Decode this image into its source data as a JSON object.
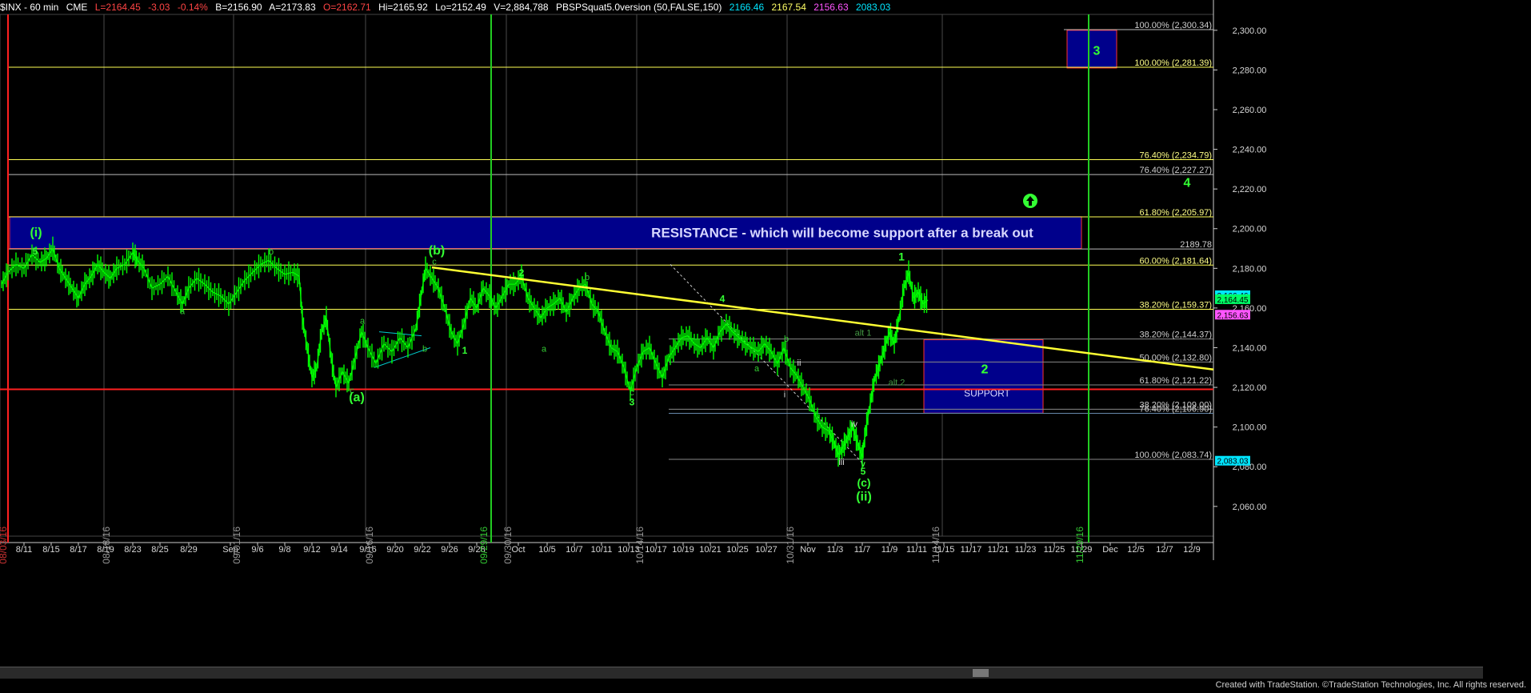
{
  "header": {
    "symbol": "$INX - 60 min",
    "exchange": "CME",
    "last": "L=2164.45",
    "change": "-3.03",
    "change_pct": "-0.14%",
    "bid": "B=2156.90",
    "ask": "A=2173.83",
    "open": "O=2162.71",
    "high": "Hi=2165.92",
    "low": "Lo=2152.49",
    "volume": "V=2,884,788",
    "indicator": "PBSPSquat5.0version (50,FALSE,150)",
    "ind_values": [
      {
        "text": "2166.46",
        "color": "#00e5ff"
      },
      {
        "text": "2167.54",
        "color": "#ffff66"
      },
      {
        "text": "2156.63",
        "color": "#ff55ff"
      },
      {
        "text": "2083.03",
        "color": "#00e5ff"
      }
    ]
  },
  "colors": {
    "background": "#000000",
    "bullish": "#00ff00",
    "bearish": "#00dd00",
    "trendline": "#ffff33",
    "resistance_box": "#00008b",
    "support_line": "#ff2020",
    "label_green": "#33ff33",
    "axis_text": "#d8d8d8"
  },
  "chart_data": {
    "type": "line",
    "title": "$INX - 60 min",
    "ylim": [
      2045,
      2308
    ],
    "xlim": [
      0,
      1517
    ],
    "grid": true,
    "y_ticks": [
      2060,
      2080,
      2100,
      2120,
      2140,
      2160,
      2180,
      2200,
      2220,
      2240,
      2260,
      2280,
      2300
    ],
    "y_tick_labels": [
      "2,060.00",
      "2,080.00",
      "2,100.00",
      "2,120.00",
      "2,140.00",
      "2,160.00",
      "2,180.00",
      "2,200.00",
      "2,220.00",
      "2,240.00",
      "2,260.00",
      "2,280.00",
      "2,300.00"
    ],
    "x_ticks": [
      {
        "x": 30,
        "label": "8/11"
      },
      {
        "x": 64,
        "label": "8/15"
      },
      {
        "x": 98,
        "label": "8/17"
      },
      {
        "x": 132,
        "label": "8/19"
      },
      {
        "x": 166,
        "label": "8/23"
      },
      {
        "x": 200,
        "label": "8/25"
      },
      {
        "x": 236,
        "label": "8/29"
      },
      {
        "x": 288,
        "label": "Sep"
      },
      {
        "x": 322,
        "label": "9/6"
      },
      {
        "x": 356,
        "label": "9/8"
      },
      {
        "x": 390,
        "label": "9/12"
      },
      {
        "x": 424,
        "label": "9/14"
      },
      {
        "x": 460,
        "label": "9/16"
      },
      {
        "x": 494,
        "label": "9/20"
      },
      {
        "x": 528,
        "label": "9/22"
      },
      {
        "x": 562,
        "label": "9/26"
      },
      {
        "x": 596,
        "label": "9/28"
      },
      {
        "x": 648,
        "label": "Oct"
      },
      {
        "x": 684,
        "label": "10/5"
      },
      {
        "x": 718,
        "label": "10/7"
      },
      {
        "x": 752,
        "label": "10/11"
      },
      {
        "x": 786,
        "label": "10/13"
      },
      {
        "x": 820,
        "label": "10/17"
      },
      {
        "x": 854,
        "label": "10/19"
      },
      {
        "x": 888,
        "label": "10/21"
      },
      {
        "x": 922,
        "label": "10/25"
      },
      {
        "x": 958,
        "label": "10/27"
      },
      {
        "x": 1010,
        "label": "Nov"
      },
      {
        "x": 1044,
        "label": "11/3"
      },
      {
        "x": 1078,
        "label": "11/7"
      },
      {
        "x": 1112,
        "label": "11/9"
      },
      {
        "x": 1146,
        "label": "11/11"
      },
      {
        "x": 1180,
        "label": "11/15"
      },
      {
        "x": 1214,
        "label": "11/17"
      },
      {
        "x": 1248,
        "label": "11/21"
      },
      {
        "x": 1282,
        "label": "11/23"
      },
      {
        "x": 1318,
        "label": "11/25"
      },
      {
        "x": 1352,
        "label": "11/29"
      },
      {
        "x": 1388,
        "label": "Dec"
      },
      {
        "x": 1420,
        "label": "12/5"
      },
      {
        "x": 1456,
        "label": "12/7"
      },
      {
        "x": 1490,
        "label": "12/9"
      }
    ],
    "date_markers": [
      {
        "x": 133,
        "label": "08/18/16",
        "color": "#9a9a9a"
      },
      {
        "x": 296,
        "label": "09/01/16",
        "color": "#9a9a9a"
      },
      {
        "x": 462,
        "label": "09/16/16",
        "color": "#9a9a9a"
      },
      {
        "x": 605,
        "label": "09/29/16",
        "color": "#33cc33"
      },
      {
        "x": 635,
        "label": "09/30/16",
        "color": "#9a9a9a"
      },
      {
        "x": 800,
        "label": "10/14/16",
        "color": "#9a9a9a"
      },
      {
        "x": 988,
        "label": "10/31/16",
        "color": "#9a9a9a"
      },
      {
        "x": 1170,
        "label": "11/14/16",
        "color": "#9a9a9a"
      },
      {
        "x": 1350,
        "label": "11/29/16",
        "color": "#33cc33"
      },
      {
        "x": 4,
        "label": "08/03/16",
        "color": "#cc3333"
      }
    ],
    "vertical_lines": [
      {
        "x": 10,
        "color": "#ff2020"
      },
      {
        "x": 614,
        "color": "#22cc22"
      },
      {
        "x": 1361,
        "color": "#22cc22"
      }
    ],
    "gray_verticals": [
      130,
      292,
      457,
      633,
      796,
      984,
      1178
    ],
    "price_path": [
      [
        2,
        2172
      ],
      [
        10,
        2178
      ],
      [
        20,
        2182
      ],
      [
        30,
        2180
      ],
      [
        40,
        2187
      ],
      [
        50,
        2183
      ],
      [
        58,
        2185
      ],
      [
        66,
        2190
      ],
      [
        74,
        2180
      ],
      [
        82,
        2175
      ],
      [
        90,
        2170
      ],
      [
        98,
        2165
      ],
      [
        106,
        2172
      ],
      [
        114,
        2176
      ],
      [
        122,
        2182
      ],
      [
        130,
        2178
      ],
      [
        138,
        2175
      ],
      [
        146,
        2180
      ],
      [
        156,
        2182
      ],
      [
        166,
        2188
      ],
      [
        172,
        2184
      ],
      [
        180,
        2180
      ],
      [
        190,
        2170
      ],
      [
        200,
        2172
      ],
      [
        210,
        2176
      ],
      [
        220,
        2168
      ],
      [
        228,
        2162
      ],
      [
        236,
        2170
      ],
      [
        246,
        2175
      ],
      [
        256,
        2172
      ],
      [
        266,
        2168
      ],
      [
        276,
        2166
      ],
      [
        286,
        2162
      ],
      [
        296,
        2168
      ],
      [
        306,
        2174
      ],
      [
        316,
        2178
      ],
      [
        326,
        2182
      ],
      [
        336,
        2184
      ],
      [
        346,
        2180
      ],
      [
        356,
        2177
      ],
      [
        366,
        2178
      ],
      [
        374,
        2176
      ],
      [
        378,
        2155
      ],
      [
        384,
        2140
      ],
      [
        390,
        2125
      ],
      [
        396,
        2130
      ],
      [
        402,
        2148
      ],
      [
        408,
        2155
      ],
      [
        414,
        2135
      ],
      [
        420,
        2120
      ],
      [
        428,
        2128
      ],
      [
        436,
        2122
      ],
      [
        444,
        2135
      ],
      [
        452,
        2148
      ],
      [
        460,
        2140
      ],
      [
        470,
        2132
      ],
      [
        480,
        2142
      ],
      [
        490,
        2138
      ],
      [
        500,
        2145
      ],
      [
        510,
        2140
      ],
      [
        520,
        2150
      ],
      [
        526,
        2165
      ],
      [
        532,
        2180
      ],
      [
        540,
        2175
      ],
      [
        548,
        2170
      ],
      [
        556,
        2160
      ],
      [
        564,
        2148
      ],
      [
        572,
        2142
      ],
      [
        580,
        2152
      ],
      [
        588,
        2165
      ],
      [
        596,
        2160
      ],
      [
        604,
        2170
      ],
      [
        612,
        2166
      ],
      [
        620,
        2160
      ],
      [
        628,
        2166
      ],
      [
        636,
        2172
      ],
      [
        644,
        2172
      ],
      [
        652,
        2176
      ],
      [
        660,
        2165
      ],
      [
        668,
        2160
      ],
      [
        676,
        2155
      ],
      [
        684,
        2160
      ],
      [
        692,
        2162
      ],
      [
        700,
        2165
      ],
      [
        708,
        2158
      ],
      [
        716,
        2165
      ],
      [
        724,
        2170
      ],
      [
        732,
        2172
      ],
      [
        740,
        2162
      ],
      [
        748,
        2158
      ],
      [
        756,
        2148
      ],
      [
        764,
        2140
      ],
      [
        772,
        2138
      ],
      [
        780,
        2130
      ],
      [
        788,
        2118
      ],
      [
        796,
        2130
      ],
      [
        804,
        2138
      ],
      [
        812,
        2140
      ],
      [
        820,
        2132
      ],
      [
        828,
        2125
      ],
      [
        836,
        2135
      ],
      [
        844,
        2140
      ],
      [
        852,
        2145
      ],
      [
        860,
        2146
      ],
      [
        868,
        2142
      ],
      [
        876,
        2140
      ],
      [
        884,
        2145
      ],
      [
        892,
        2140
      ],
      [
        900,
        2148
      ],
      [
        908,
        2152
      ],
      [
        916,
        2148
      ],
      [
        924,
        2145
      ],
      [
        932,
        2142
      ],
      [
        940,
        2140
      ],
      [
        948,
        2138
      ],
      [
        956,
        2142
      ],
      [
        964,
        2138
      ],
      [
        972,
        2132
      ],
      [
        980,
        2140
      ],
      [
        988,
        2130
      ],
      [
        996,
        2126
      ],
      [
        1004,
        2120
      ],
      [
        1012,
        2114
      ],
      [
        1020,
        2105
      ],
      [
        1028,
        2100
      ],
      [
        1036,
        2098
      ],
      [
        1042,
        2093
      ],
      [
        1048,
        2086
      ],
      [
        1054,
        2090
      ],
      [
        1060,
        2095
      ],
      [
        1066,
        2100
      ],
      [
        1072,
        2092
      ],
      [
        1078,
        2085
      ],
      [
        1082,
        2098
      ],
      [
        1088,
        2112
      ],
      [
        1094,
        2125
      ],
      [
        1100,
        2132
      ],
      [
        1106,
        2140
      ],
      [
        1112,
        2148
      ],
      [
        1118,
        2142
      ],
      [
        1124,
        2155
      ],
      [
        1130,
        2170
      ],
      [
        1136,
        2178
      ],
      [
        1142,
        2165
      ],
      [
        1148,
        2168
      ],
      [
        1154,
        2162
      ],
      [
        1160,
        2164
      ]
    ],
    "horizontal_levels": [
      {
        "y": 2300.34,
        "label": "100.00% (2,300.34)",
        "color": "#bbbbbb",
        "x1": 1330
      },
      {
        "y": 2281.39,
        "label": "100.00% (2,281.39)",
        "color": "#ffff55",
        "x1": 10
      },
      {
        "y": 2234.79,
        "label": "76.40% (2,234.79)",
        "color": "#ffff55",
        "x1": 10
      },
      {
        "y": 2227.27,
        "label": "76.40% (2,227.27)",
        "color": "#bbbbbb",
        "x1": 10
      },
      {
        "y": 2205.97,
        "label": "61.80% (2,205.97)",
        "color": "#ffff55",
        "x1": 10
      },
      {
        "y": 2189.78,
        "label": "2189.78",
        "color": "#bbbbbb",
        "x1": 10
      },
      {
        "y": 2181.64,
        "label": "60.00% (2,181.64)",
        "color": "#ffff55",
        "x1": 10
      },
      {
        "y": 2159.37,
        "label": "38.20% (2,159.37)",
        "color": "#ffff55",
        "x1": 10
      },
      {
        "y": 2144.37,
        "label": "38.20% (2,144.37)",
        "color": "#888888",
        "x1": 836
      },
      {
        "y": 2132.8,
        "label": "50.00% (2,132.80)",
        "color": "#888888",
        "x1": 836
      },
      {
        "y": 2121.22,
        "label": "61.80% (2,121.22)",
        "color": "#888888",
        "x1": 836
      },
      {
        "y": 2109.0,
        "label": "38.20% (2,109.00)",
        "color": "#888888",
        "x1": 836
      },
      {
        "y": 2106.9,
        "label": "76.40% (2,106.90)",
        "color": "#6688aa",
        "x1": 836
      },
      {
        "y": 2083.74,
        "label": "100.00% (2,083.74)",
        "color": "#888888",
        "x1": 836
      }
    ],
    "support_line": 2119,
    "trendline": [
      [
        540,
        2180.5
      ],
      [
        1517,
        2129
      ]
    ],
    "resistance_box": {
      "x0": 12,
      "x1": 1352,
      "y0": 2190,
      "y1": 2206,
      "label": "RESISTANCE - which will become support after a break out"
    },
    "support_box": {
      "x0": 1155,
      "x1": 1304,
      "y0": 2107,
      "y1": 2144,
      "label": "SUPPORT",
      "wave": "2"
    },
    "target_box": {
      "x0": 1334,
      "x1": 1396,
      "y0": 2281,
      "y1": 2300,
      "wave": "3"
    },
    "price_tags": [
      {
        "y": 2166.46,
        "text": "2,166.46",
        "color": "#00e5ff"
      },
      {
        "y": 2164.45,
        "text": "2,164.45",
        "color": "#00ff66"
      },
      {
        "y": 2156.63,
        "text": "2,156.63",
        "color": "#ff55ff"
      },
      {
        "y": 2083.03,
        "text": "2,083.03",
        "color": "#00e5ff"
      }
    ],
    "wave_labels": [
      {
        "x": 45,
        "y": 2196,
        "text": "(i)",
        "size": 16
      },
      {
        "x": 44,
        "y": 2187,
        "text": "5",
        "size": 12
      },
      {
        "x": 546,
        "y": 2187,
        "text": "(b)",
        "size": 16
      },
      {
        "x": 446,
        "y": 2113,
        "text": "(a)",
        "size": 16
      },
      {
        "x": 1127,
        "y": 2184,
        "text": "1",
        "size": 14
      },
      {
        "x": 1231,
        "y": 2127,
        "text": "2",
        "size": 16
      },
      {
        "x": 1484,
        "y": 2221,
        "text": "4",
        "size": 16
      },
      {
        "x": 652,
        "y": 2176,
        "text": "2",
        "size": 12
      },
      {
        "x": 903,
        "y": 2163,
        "text": "4",
        "size": 12
      },
      {
        "x": 581,
        "y": 2137,
        "text": "1",
        "size": 12
      },
      {
        "x": 790,
        "y": 2111,
        "text": "3",
        "size": 12
      },
      {
        "x": 1080,
        "y": 2063,
        "text": "(ii)",
        "size": 16
      },
      {
        "x": 1080,
        "y": 2070,
        "text": "(c)",
        "size": 14
      },
      {
        "x": 1079,
        "y": 2076,
        "text": "5",
        "size": 12
      },
      {
        "x": 1079,
        "y": 2080,
        "text": "v",
        "size": 10
      }
    ],
    "minor_labels": [
      {
        "x": 339,
        "y": 2187,
        "text": "b"
      },
      {
        "x": 228,
        "y": 2157,
        "text": "a"
      },
      {
        "x": 453,
        "y": 2152,
        "text": "a"
      },
      {
        "x": 531,
        "y": 2138,
        "text": "b"
      },
      {
        "x": 440,
        "y": 2117,
        "text": "c"
      },
      {
        "x": 543,
        "y": 2182,
        "text": "c"
      },
      {
        "x": 734,
        "y": 2174,
        "text": "b"
      },
      {
        "x": 680,
        "y": 2138,
        "text": "a"
      },
      {
        "x": 790,
        "y": 2116,
        "text": "c"
      },
      {
        "x": 946,
        "y": 2128,
        "text": "a"
      },
      {
        "x": 983,
        "y": 2143,
        "text": "b"
      },
      {
        "x": 999,
        "y": 2131,
        "text": "ii"
      },
      {
        "x": 981,
        "y": 2115,
        "text": "i"
      },
      {
        "x": 1068,
        "y": 2100,
        "text": "iv"
      },
      {
        "x": 1052,
        "y": 2081,
        "text": "iii"
      },
      {
        "x": 1079,
        "y": 2146,
        "text": "alt 1"
      },
      {
        "x": 1121,
        "y": 2121,
        "text": "alt 2"
      }
    ],
    "arrow": {
      "x": 1288,
      "y": 2214
    }
  },
  "footer": {
    "credit": "Created with TradeStation. ©TradeStation Technologies, Inc. All rights reserved."
  }
}
